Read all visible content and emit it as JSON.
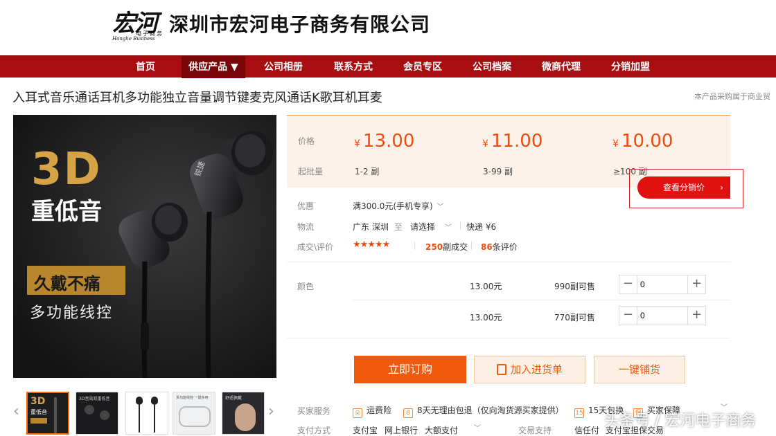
{
  "header": {
    "logo_text": "宏河",
    "logo_sub": "电子商务",
    "logo_en": "Honghe Business",
    "company_name": "深圳市宏河电子商务有限公司"
  },
  "nav": {
    "items": [
      {
        "label": "首页"
      },
      {
        "label": "供应产品 ▼"
      },
      {
        "label": "公司相册"
      },
      {
        "label": "联系方式"
      },
      {
        "label": "会员专区"
      },
      {
        "label": "公司档案"
      },
      {
        "label": "微商代理"
      },
      {
        "label": "分销加盟"
      }
    ],
    "active_index": 1
  },
  "product": {
    "title": "入耳式音乐通话耳机多功能独立音量调节键麦克风通话K歌耳机耳麦",
    "notice": "本产品采购属于商业贸"
  },
  "main_image": {
    "headline": "3D",
    "sub": "重低音",
    "badge": "久戴不痛",
    "feature": "多功能线控",
    "brand_mark": "锐捷"
  },
  "thumbs": {
    "t1_a": "3D",
    "t1_b": "重低音",
    "t2": "3D音效双重低音",
    "t4": "多功能线控 一键多用",
    "t5": "舒适佩戴"
  },
  "pricing": {
    "price_label": "价格",
    "moq_label": "起批量",
    "currency": "¥",
    "tiers": [
      {
        "price": "13.00",
        "qty": "1-2 副"
      },
      {
        "price": "11.00",
        "qty": "3-99 副"
      },
      {
        "price": "10.00",
        "qty": "≥100 副"
      }
    ],
    "distrib_price_btn": "查看分销价"
  },
  "details": {
    "promo_label": "优惠",
    "promo_value": "满300.0元(手机专享)",
    "logistics_label": "物流",
    "from": "广东 深圳",
    "to_word": "至",
    "to_select": "请选择",
    "express": "快递 ¥6",
    "deals_label": "成交\\评价",
    "stars": "★★★★★",
    "deals_count": "250",
    "deals_unit": "副成交",
    "reviews_count": "86",
    "reviews_unit": "条评价"
  },
  "variants": {
    "color_label": "颜色",
    "rows": [
      {
        "price": "13.00元",
        "stock": "990",
        "stock_unit": "副可售",
        "qty": "0"
      },
      {
        "price": "13.00元",
        "stock": "770",
        "stock_unit": "副可售",
        "qty": "0"
      }
    ]
  },
  "actions": {
    "buy": "立即订购",
    "cart": "加入进货单",
    "distribute": "一键铺货"
  },
  "services": {
    "buyer_label": "买家服务",
    "items": [
      "运费险",
      "8天无理由包退（仅向淘货源买家提供）",
      "15天包换",
      "买家保障"
    ],
    "pay_label": "支付方式",
    "pay_items": [
      "支付宝",
      "网上银行",
      "大额支付"
    ],
    "trade_label": "交易支持",
    "trade_items": [
      "信任付",
      "支付宝担保交易"
    ]
  },
  "watermark": "头条号 / 宏河电子商务",
  "colors": {
    "nav_bg": "#a80d12",
    "accent": "#f04b0c",
    "buy_btn": "#f05a0e",
    "price_box_bg": "#fdf2e9"
  }
}
